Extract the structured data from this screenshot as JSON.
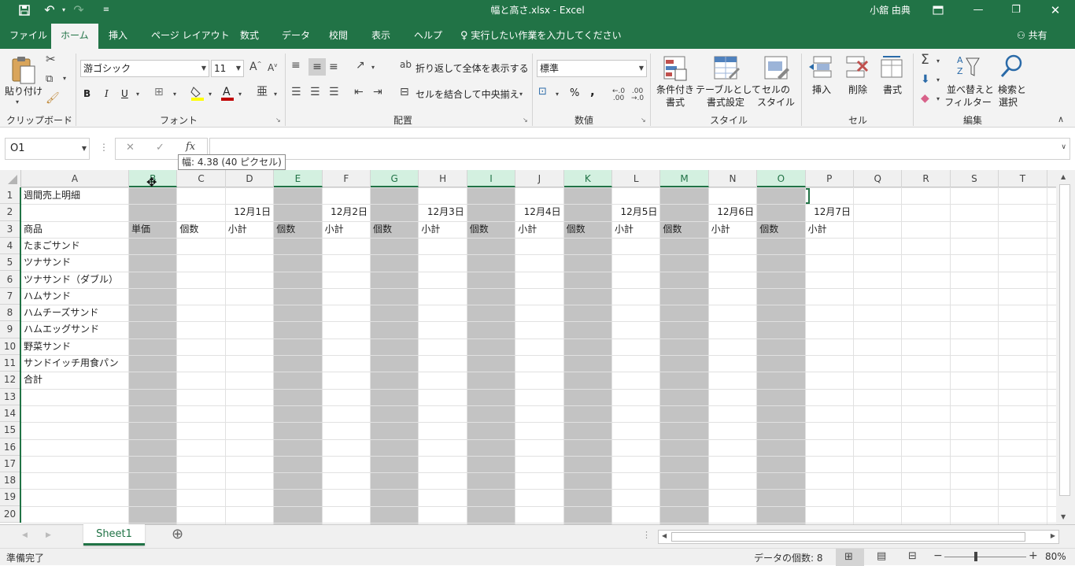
{
  "title_bar": {
    "save_icon": "save-icon",
    "undo_icon": "undo-icon",
    "redo_icon": "redo-icon",
    "customize_icon": "customize-qat-icon",
    "doc_title": "幅と高さ.xlsx  -  Excel",
    "user_name": "小舘 由典",
    "ribbon_options_icon": "ribbon-display-options-icon",
    "minimize": "—",
    "restore": "❐",
    "close": "✕"
  },
  "tabs": {
    "file": "ファイル",
    "home": "ホーム",
    "insert": "挿入",
    "page_layout": "ページ レイアウト",
    "formulas": "数式",
    "data": "データ",
    "review": "校閲",
    "view": "表示",
    "help": "ヘルプ",
    "tell_me": "実行したい作業を入力してください",
    "share": "共有"
  },
  "ribbon": {
    "clipboard": {
      "paste": "貼り付け",
      "label": "クリップボード"
    },
    "font": {
      "name": "游ゴシック",
      "size": "11",
      "bold": "B",
      "italic": "I",
      "underline": "U",
      "label": "フォント",
      "font_color": "#c00000",
      "fill_color": "#ffff00"
    },
    "alignment": {
      "wrap": "折り返して全体を表示する",
      "merge": "セルを結合して中央揃え",
      "label": "配置"
    },
    "number": {
      "format": "標準",
      "percent": "%",
      "comma": ",",
      "label": "数値"
    },
    "styles": {
      "conditional_1": "条件付き",
      "conditional_2": "書式",
      "table_1": "テーブルとして",
      "table_2": "書式設定",
      "cell_1": "セルの",
      "cell_2": "スタイル",
      "label": "スタイル"
    },
    "cells": {
      "insert": "挿入",
      "delete": "削除",
      "format": "書式",
      "label": "セル"
    },
    "editing": {
      "sort_1": "並べ替えと",
      "sort_2": "フィルター",
      "find_1": "検索と",
      "find_2": "選択",
      "label": "編集"
    }
  },
  "formula_bar": {
    "name_box": "O1",
    "fx": "fx",
    "cancel": "✕",
    "enter": "✓",
    "content": ""
  },
  "tooltip": "幅: 4.38 (40 ピクセル)",
  "columns": [
    "A",
    "B",
    "C",
    "D",
    "E",
    "F",
    "G",
    "H",
    "I",
    "J",
    "K",
    "L",
    "M",
    "N",
    "O",
    "P",
    "Q",
    "R",
    "S",
    "T",
    "U"
  ],
  "selected_columns": [
    "B",
    "E",
    "G",
    "I",
    "K",
    "M",
    "O"
  ],
  "rows": [
    "1",
    "2",
    "3",
    "4",
    "5",
    "6",
    "7",
    "8",
    "9",
    "10",
    "11",
    "12",
    "13",
    "14",
    "15",
    "16",
    "17",
    "18",
    "19",
    "20"
  ],
  "cells": {
    "a1": "週間売上明細",
    "a3": "商品",
    "items": [
      "たまごサンド",
      "ツナサンド",
      "ツナサンド（ダブル）",
      "ハムサンド",
      "ハムチーズサンド",
      "ハムエッグサンド",
      "野菜サンド",
      "サンドイッチ用食パン",
      "合計"
    ],
    "dates": [
      "12月1日",
      "12月2日",
      "12月3日",
      "12月4日",
      "12月5日",
      "12月6日",
      "12月7日"
    ],
    "unit_price": "単価",
    "qty": "個数",
    "subtotal": "小計"
  },
  "sheet_tabs": {
    "sheet1": "Sheet1",
    "add": "⊕"
  },
  "status_bar": {
    "ready": "準備完了",
    "count": "データの個数: 8",
    "zoom": "80%",
    "minus": "−",
    "plus": "+"
  }
}
